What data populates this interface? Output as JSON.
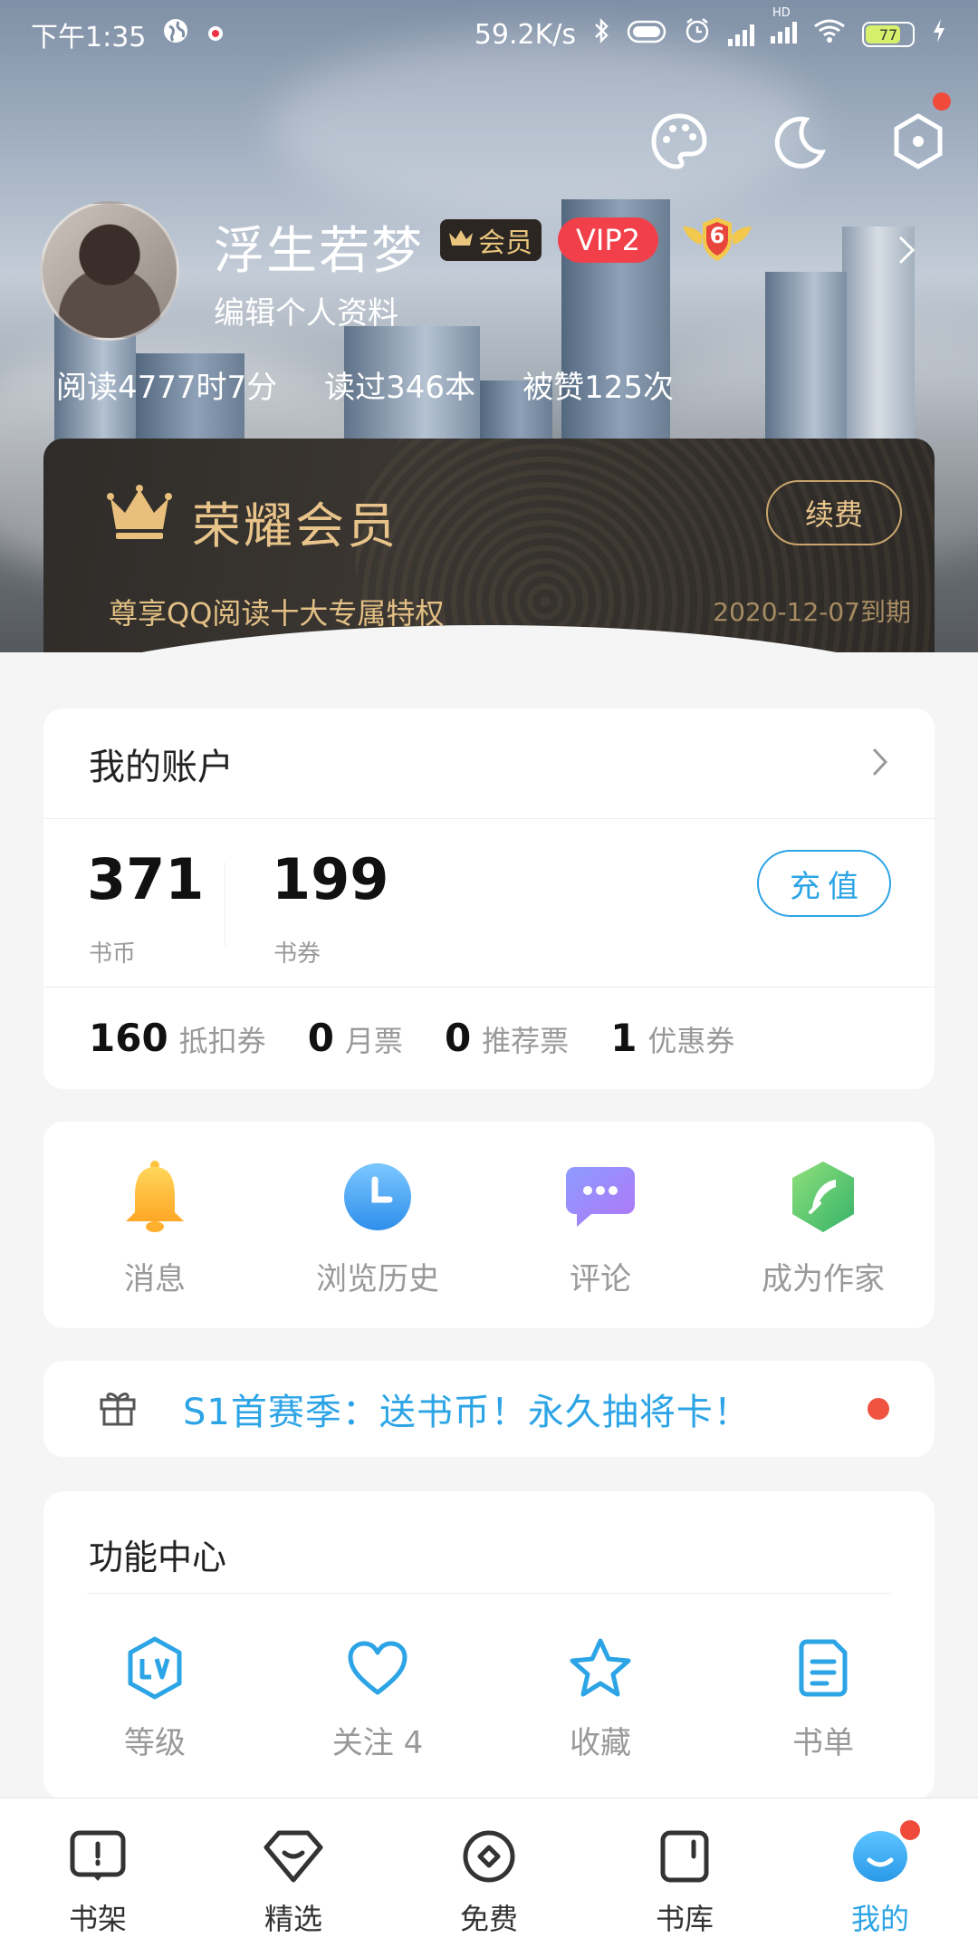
{
  "status_bar": {
    "time": "下午1:35",
    "net_speed": "59.2K/s",
    "battery": "77",
    "hd_label": "HD"
  },
  "profile": {
    "name": "浮生若梦",
    "member_badge": "会员",
    "vip_badge": "VIP2",
    "level_badge": "6",
    "edit_label": "编辑个人资料",
    "stats": {
      "reading_time": "阅读4777时7分",
      "books_read": "读过346本",
      "likes": "被赞125次"
    }
  },
  "membership": {
    "title": "荣耀会员",
    "renew_label": "续费",
    "subtitle": "尊享QQ阅读十大专属特权",
    "expiry": "2020-12-07到期"
  },
  "account": {
    "title": "我的账户",
    "coins_value": "371",
    "coins_label": "书币",
    "vouchers_value": "199",
    "vouchers_label": "书券",
    "recharge_label": "充值",
    "tickets": [
      {
        "value": "160",
        "label": "抵扣券"
      },
      {
        "value": "0",
        "label": "月票"
      },
      {
        "value": "0",
        "label": "推荐票"
      },
      {
        "value": "1",
        "label": "优惠券"
      }
    ]
  },
  "quick_actions": [
    {
      "label": "消息",
      "icon": "bell-icon"
    },
    {
      "label": "浏览历史",
      "icon": "clock-icon"
    },
    {
      "label": "评论",
      "icon": "comment-icon"
    },
    {
      "label": "成为作家",
      "icon": "quill-icon"
    }
  ],
  "promo": {
    "text": "S1首赛季：送书币！永久抽将卡！",
    "icon": "gift-icon"
  },
  "function_center": {
    "title": "功能中心",
    "items": [
      {
        "label": "等级",
        "icon": "level-icon"
      },
      {
        "label": "关注 4",
        "icon": "heart-icon"
      },
      {
        "label": "收藏",
        "icon": "star-icon"
      },
      {
        "label": "书单",
        "icon": "list-icon"
      }
    ]
  },
  "bottom_nav": [
    {
      "label": "书架",
      "icon": "bookshelf-icon"
    },
    {
      "label": "精选",
      "icon": "diamond-icon"
    },
    {
      "label": "免费",
      "icon": "free-icon"
    },
    {
      "label": "书库",
      "icon": "library-icon"
    },
    {
      "label": "我的",
      "icon": "profile-mascot-icon",
      "active": true
    }
  ],
  "colors": {
    "accent": "#2ca4e6",
    "gold": "#e8c48b",
    "vip_red": "#f1404a",
    "alert_red": "#f0533f"
  }
}
